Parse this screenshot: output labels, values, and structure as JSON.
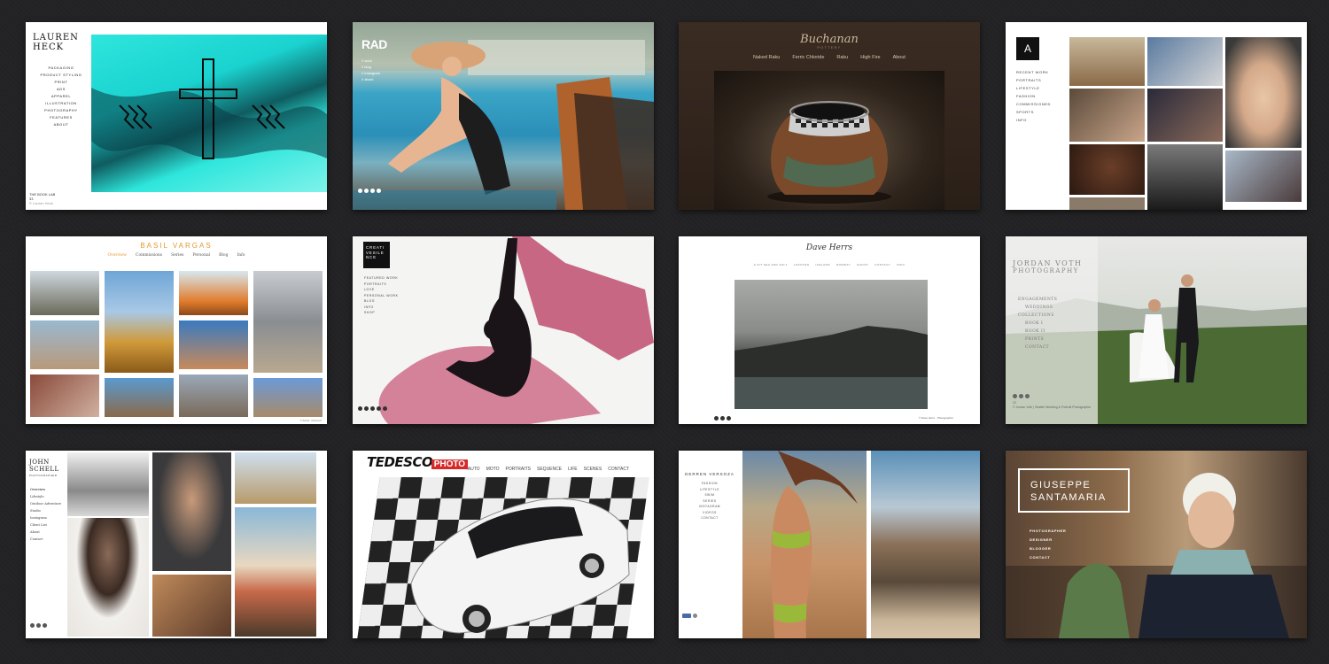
{
  "sites": {
    "lauren": {
      "logo": "LAUREN HECK",
      "nav": [
        "Packaging",
        "Product Styling",
        "Print",
        "Ads",
        "Apparel",
        "Illustration",
        "Photography",
        "Features",
        "About"
      ],
      "caption_title": "THE BOOK LAB",
      "caption_num": "33",
      "caption_credit": "© Lauren Heck"
    },
    "rad": {
      "logo": "RAD",
      "nav": [
        "// work",
        "// blog",
        "// instagram",
        "// about"
      ]
    },
    "buchanan": {
      "logo": "Buchanan",
      "sub": "POTTERY",
      "nav": [
        "Naked Raku",
        "Ferric Chloride",
        "Raku",
        "High Fire",
        "About"
      ]
    },
    "aportfolio": {
      "logo": "A",
      "nav": [
        "Recent Work",
        "Portraits",
        "Lifestyle",
        "Fashion",
        "Commissioned",
        "Sports",
        "Info"
      ]
    },
    "basil": {
      "title": "BASIL VARGAS",
      "nav": [
        "Overview",
        "Commissions",
        "Series",
        "Personal",
        "Blog",
        "Info"
      ],
      "footer": "© BASIL VARGAS"
    },
    "creative": {
      "logo": "CREATIVESILENCE",
      "nav": [
        "Featured Work",
        "Portraits",
        "Love",
        "Personal Work",
        "Blog",
        "Info",
        "Shop"
      ]
    },
    "dave": {
      "logo": "Dave Herrs",
      "nav": [
        "A Sit Sea and Salt",
        "Lofoten",
        "Iceland",
        "Norway",
        "Shoot",
        "Contact",
        "Info"
      ],
      "footer": "© Dave Herrs · Photographer"
    },
    "jordan": {
      "logo": "JORDAN VOTH",
      "sub": "PHOTOGRAPHY",
      "nav": [
        "ENGAGEMENTS",
        "WEDDINGS",
        "COLLECTIONS",
        "BOOK I",
        "BOOK II",
        "PRINTS",
        "CONTACT"
      ],
      "caption_num": "22",
      "caption_credit": "© Jordan Voth | Seattle Wedding & Portrait Photographer"
    },
    "john": {
      "logo": "JOHN SCHELL",
      "sub": "PHOTOGRAPHER",
      "nav": [
        "Overview",
        "Lifestyle",
        "Outdoor Adventure",
        "Studio",
        "Instagram",
        "Client List",
        "About",
        "Contact"
      ]
    },
    "tedesco": {
      "logo": "TEDESCO",
      "logo2": "PHOTO",
      "nav": [
        "AUTO",
        "MOTO",
        "PORTRAITS",
        "SEQUENCE",
        "LIFE",
        "SCENES",
        "CONTACT"
      ]
    },
    "derren": {
      "logo": "DERREN VERSOZA",
      "nav": [
        "Fashion",
        "Lifestyle",
        "Swim",
        "Series",
        "Instagram",
        "Videos",
        "Contact"
      ]
    },
    "giuseppe": {
      "title1": "GIUSEPPE",
      "title2": "SANTAMARIA",
      "nav": [
        "PHOTOGRAPHER",
        "DESIGNER",
        "BLOGGER",
        "CONTACT"
      ]
    }
  },
  "colors": {
    "background": "#222224",
    "aqua": "#2ee6dc",
    "basil_orange": "#e8962e"
  }
}
